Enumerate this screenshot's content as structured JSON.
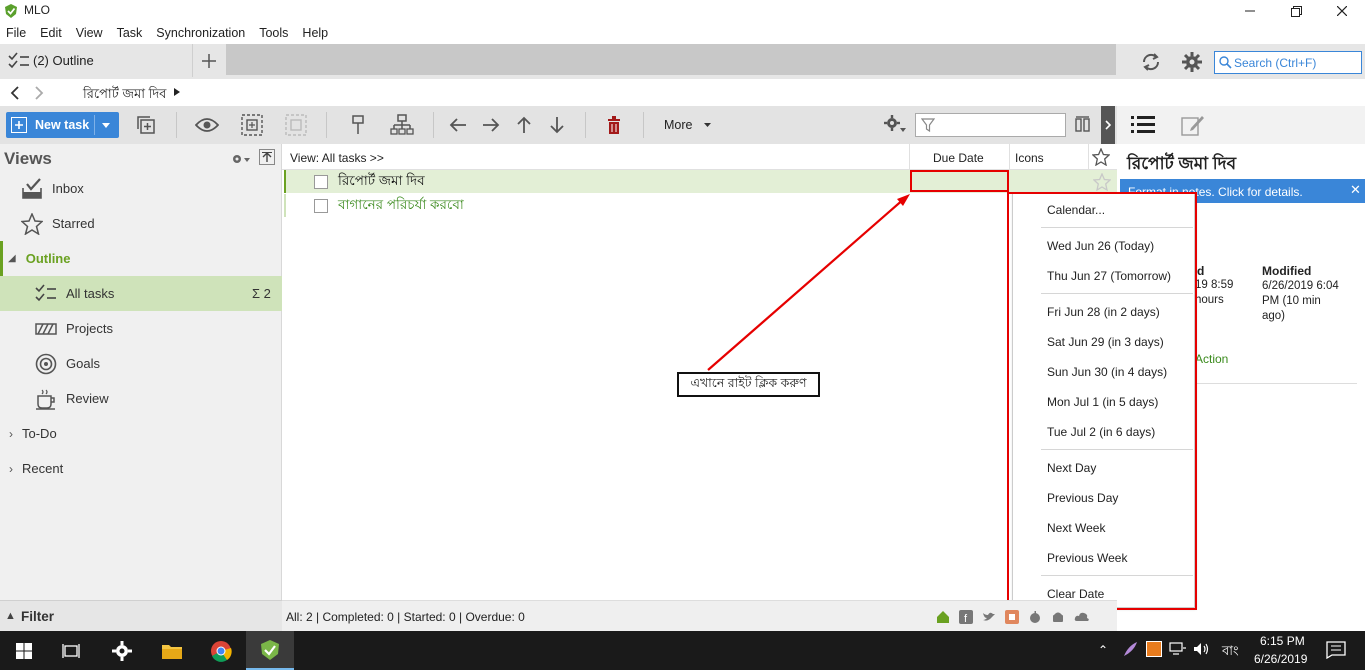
{
  "app": {
    "title": "MLO"
  },
  "menu": [
    "File",
    "Edit",
    "View",
    "Task",
    "Synchronization",
    "Tools",
    "Help"
  ],
  "tabs": {
    "active": "(2) Outline"
  },
  "search": {
    "placeholder": "Search (Ctrl+F)"
  },
  "breadcrumb": {
    "item": "রিপোর্ট জমা দিব"
  },
  "toolbar": {
    "new_task": "New task",
    "more": "More"
  },
  "views": {
    "title": "Views",
    "items": {
      "inbox": "Inbox",
      "starred": "Starred",
      "outline": "Outline",
      "all_tasks": "All tasks",
      "all_tasks_count": "Σ 2",
      "projects": "Projects",
      "goals": "Goals",
      "review": "Review",
      "todo": "To-Do",
      "recent": "Recent"
    },
    "filter": "Filter"
  },
  "columns": {
    "view": "View: All tasks >>",
    "due": "Due Date",
    "icons": "Icons"
  },
  "tasks": [
    {
      "title": "রিপোর্ট জমা দিব",
      "selected": true
    },
    {
      "title": "বাগানের পরিচর্যা করবো",
      "selected": false
    }
  ],
  "annotation": {
    "text": "এখানে রাইট ক্লিক করুণ"
  },
  "context_menu": {
    "calendar": "Calendar...",
    "today": "Wed Jun 26 (Today)",
    "tomorrow": "Thu Jun 27 (Tomorrow)",
    "d2": "Fri Jun 28 (in 2 days)",
    "d3": "Sat Jun 29 (in 3 days)",
    "d4": "Sun Jun 30 (in 4 days)",
    "d5": "Mon Jul 1 (in 5 days)",
    "d6": "Tue Jul 2 (in 6 days)",
    "next_day": "Next Day",
    "prev_day": "Previous Day",
    "next_week": "Next Week",
    "prev_week": "Previous Week",
    "clear": "Clear Date"
  },
  "right_panel": {
    "title": "রিপোর্ট জমা দিব",
    "notice": "Format in notes. Click  for details.",
    "created_partial": "d",
    "created_line1": "19 8:59",
    "created_line2": "hours",
    "modified_label": "Modified",
    "modified_value": "6/26/2019 6:04 PM (10 min ago)",
    "action": "Action"
  },
  "status": {
    "summary": "All: 2 | Completed: 0 | Started: 0 | Overdue: 0"
  },
  "taskbar": {
    "time": "6:15 PM",
    "date": "6/26/2019",
    "lang": "বাং"
  },
  "colors": {
    "accent": "#3a86d8",
    "green": "#6aa121",
    "selected_row": "#e3efd6",
    "red": "#e60000"
  }
}
